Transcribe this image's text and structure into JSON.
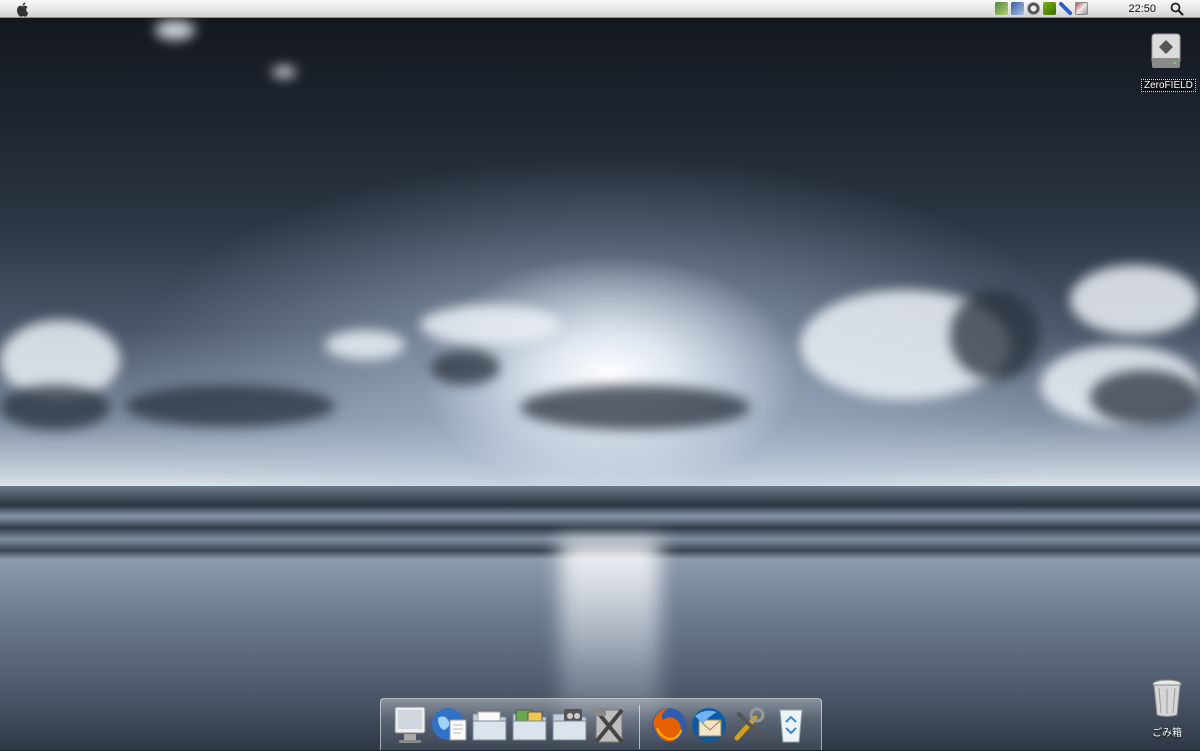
{
  "menubar": {
    "clock": "22:50",
    "tray_icons": [
      "user-network-icon",
      "display-icon",
      "sound-icon",
      "nvidia-icon",
      "pen-icon",
      "network-status-icon"
    ]
  },
  "desktop": {
    "drive": {
      "label": "ZeroFIELD",
      "icon": "hard-drive-icon"
    },
    "trash": {
      "label": "ごみ箱",
      "icon": "trash-icon"
    }
  },
  "dock": {
    "items": [
      {
        "name": "dock-finder",
        "icon": "monitor-icon"
      },
      {
        "name": "dock-browser",
        "icon": "globe-icon"
      },
      {
        "name": "dock-documents-folder",
        "icon": "folder-icon"
      },
      {
        "name": "dock-pictures-folder",
        "icon": "folder-icon"
      },
      {
        "name": "dock-music-folder",
        "icon": "folder-icon"
      },
      {
        "name": "dock-utilities",
        "icon": "tools-icon"
      },
      {
        "name": "dock-firefox",
        "icon": "firefox-icon"
      },
      {
        "name": "dock-thunderbird",
        "icon": "thunderbird-icon"
      },
      {
        "name": "dock-settings",
        "icon": "wrench-icon"
      },
      {
        "name": "dock-recycle-bin",
        "icon": "recycle-bin-icon"
      }
    ]
  },
  "colors": {
    "menubar": "#e6e6e6",
    "sky_dark": "#1c232d",
    "horizon": "#dfe6ee",
    "sun": "#ffffff"
  }
}
